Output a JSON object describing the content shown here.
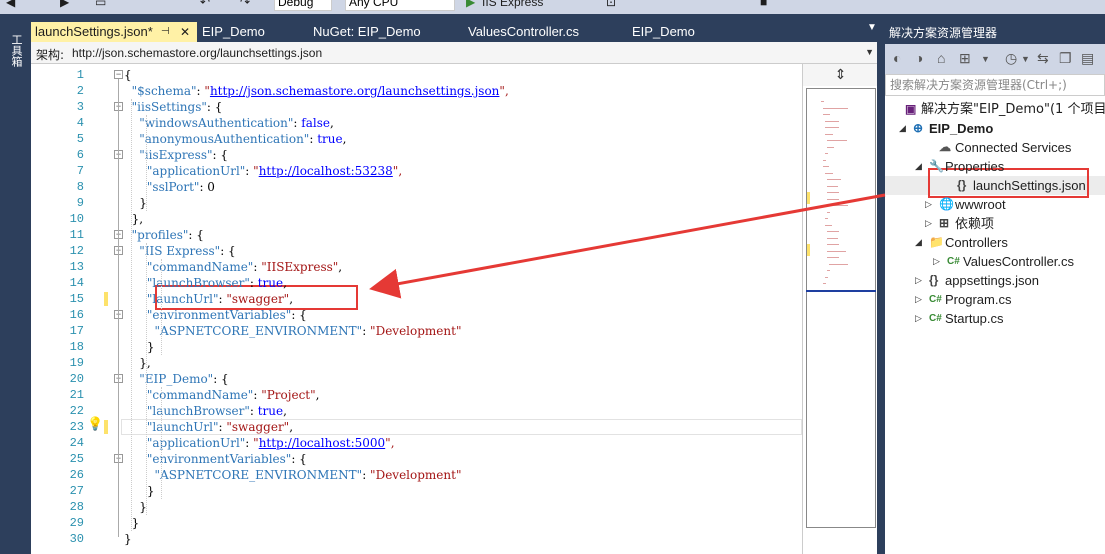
{
  "toolbar": {
    "config": "Debug",
    "platform": "Any CPU",
    "run_target": "IIS Express"
  },
  "left_tool": {
    "label": "工具箱"
  },
  "tabs": [
    {
      "label": "launchSettings.json*",
      "active": true
    },
    {
      "label": "EIP_Demo"
    },
    {
      "label": "NuGet: EIP_Demo"
    },
    {
      "label": "ValuesController.cs"
    },
    {
      "label": "EIP_Demo"
    }
  ],
  "schema_bar": {
    "label": "架构:",
    "value": "http://json.schemastore.org/launchsettings.json"
  },
  "code": {
    "line_numbers": [
      "1",
      "2",
      "3",
      "4",
      "5",
      "6",
      "7",
      "8",
      "9",
      "10",
      "11",
      "12",
      "13",
      "14",
      "15",
      "16",
      "17",
      "18",
      "19",
      "20",
      "21",
      "22",
      "23",
      "24",
      "25",
      "26",
      "27",
      "28",
      "29",
      "30"
    ],
    "lines": [
      [
        {
          "t": "{",
          "c": "n"
        }
      ],
      [
        {
          "t": "  \"$schema\"",
          "c": "k"
        },
        {
          "t": ": ",
          "c": "n"
        },
        {
          "t": "\"",
          "c": "s"
        },
        {
          "t": "http://json.schemastore.org/launchsettings.json",
          "c": "u"
        },
        {
          "t": "\",",
          "c": "s"
        }
      ],
      [
        {
          "t": "  \"iisSettings\"",
          "c": "k"
        },
        {
          "t": ": {",
          "c": "n"
        }
      ],
      [
        {
          "t": "    \"windowsAuthentication\"",
          "c": "k"
        },
        {
          "t": ": ",
          "c": "n"
        },
        {
          "t": "false",
          "c": "b"
        },
        {
          "t": ",",
          "c": "n"
        }
      ],
      [
        {
          "t": "    \"anonymousAuthentication\"",
          "c": "k"
        },
        {
          "t": ": ",
          "c": "n"
        },
        {
          "t": "true",
          "c": "b"
        },
        {
          "t": ",",
          "c": "n"
        }
      ],
      [
        {
          "t": "    \"iisExpress\"",
          "c": "k"
        },
        {
          "t": ": {",
          "c": "n"
        }
      ],
      [
        {
          "t": "      \"applicationUrl\"",
          "c": "k"
        },
        {
          "t": ": ",
          "c": "n"
        },
        {
          "t": "\"",
          "c": "s"
        },
        {
          "t": "http://localhost:53238",
          "c": "u"
        },
        {
          "t": "\",",
          "c": "s"
        }
      ],
      [
        {
          "t": "      \"sslPort\"",
          "c": "k"
        },
        {
          "t": ": 0",
          "c": "n"
        }
      ],
      [
        {
          "t": "    }",
          "c": "n"
        }
      ],
      [
        {
          "t": "  },",
          "c": "n"
        }
      ],
      [
        {
          "t": "  \"profiles\"",
          "c": "k"
        },
        {
          "t": ": {",
          "c": "n"
        }
      ],
      [
        {
          "t": "    \"IIS Express\"",
          "c": "k"
        },
        {
          "t": ": {",
          "c": "n"
        }
      ],
      [
        {
          "t": "      \"commandName\"",
          "c": "k"
        },
        {
          "t": ": ",
          "c": "n"
        },
        {
          "t": "\"IISExpress\"",
          "c": "s"
        },
        {
          "t": ",",
          "c": "n"
        }
      ],
      [
        {
          "t": "      \"launchBrowser\"",
          "c": "k"
        },
        {
          "t": ": ",
          "c": "n"
        },
        {
          "t": "true",
          "c": "b"
        },
        {
          "t": ",",
          "c": "n"
        }
      ],
      [
        {
          "t": "      \"launchUrl\"",
          "c": "k"
        },
        {
          "t": ": ",
          "c": "n"
        },
        {
          "t": "\"swagger\"",
          "c": "s"
        },
        {
          "t": ",",
          "c": "n"
        }
      ],
      [
        {
          "t": "      \"environmentVariables\"",
          "c": "k"
        },
        {
          "t": ": {",
          "c": "n"
        }
      ],
      [
        {
          "t": "        \"ASPNETCORE_ENVIRONMENT\"",
          "c": "k"
        },
        {
          "t": ": ",
          "c": "n"
        },
        {
          "t": "\"Development\"",
          "c": "s"
        }
      ],
      [
        {
          "t": "      }",
          "c": "n"
        }
      ],
      [
        {
          "t": "    },",
          "c": "n"
        }
      ],
      [
        {
          "t": "    \"EIP_Demo\"",
          "c": "k"
        },
        {
          "t": ": {",
          "c": "n"
        }
      ],
      [
        {
          "t": "      \"commandName\"",
          "c": "k"
        },
        {
          "t": ": ",
          "c": "n"
        },
        {
          "t": "\"Project\"",
          "c": "s"
        },
        {
          "t": ",",
          "c": "n"
        }
      ],
      [
        {
          "t": "      \"launchBrowser\"",
          "c": "k"
        },
        {
          "t": ": ",
          "c": "n"
        },
        {
          "t": "true",
          "c": "b"
        },
        {
          "t": ",",
          "c": "n"
        }
      ],
      [
        {
          "t": "      \"launchUrl\"",
          "c": "k"
        },
        {
          "t": ": ",
          "c": "n"
        },
        {
          "t": "\"swagger\"",
          "c": "s"
        },
        {
          "t": ",",
          "c": "n"
        }
      ],
      [
        {
          "t": "      \"applicationUrl\"",
          "c": "k"
        },
        {
          "t": ": ",
          "c": "n"
        },
        {
          "t": "\"",
          "c": "s"
        },
        {
          "t": "http://localhost:5000",
          "c": "u"
        },
        {
          "t": "\",",
          "c": "s"
        }
      ],
      [
        {
          "t": "      \"environmentVariables\"",
          "c": "k"
        },
        {
          "t": ": {",
          "c": "n"
        }
      ],
      [
        {
          "t": "        \"ASPNETCORE_ENVIRONMENT\"",
          "c": "k"
        },
        {
          "t": ": ",
          "c": "n"
        },
        {
          "t": "\"Development\"",
          "c": "s"
        }
      ],
      [
        {
          "t": "      }",
          "c": "n"
        }
      ],
      [
        {
          "t": "    }",
          "c": "n"
        }
      ],
      [
        {
          "t": "  }",
          "c": "n"
        }
      ],
      [
        {
          "t": "}",
          "c": "n"
        }
      ]
    ]
  },
  "solution_explorer": {
    "title": "解决方案资源管理器",
    "search_placeholder": "搜索解决方案资源管理器(Ctrl+;)",
    "tree": [
      {
        "label": "解决方案\"EIP_Demo\"(1 个项目)",
        "icon": "solution-icon"
      },
      {
        "label": "EIP_Demo",
        "icon": "web-project-icon",
        "bold": true
      },
      {
        "label": "Connected Services",
        "icon": "cloud-icon"
      },
      {
        "label": "Properties",
        "icon": "wrench-icon"
      },
      {
        "label": "launchSettings.json",
        "icon": "json-file-icon",
        "selected": true
      },
      {
        "label": "wwwroot",
        "icon": "globe-icon"
      },
      {
        "label": "依赖项",
        "icon": "dependencies-icon"
      },
      {
        "label": "Controllers",
        "icon": "folder-icon"
      },
      {
        "label": "ValuesController.cs",
        "icon": "csharp-file-icon"
      },
      {
        "label": "appsettings.json",
        "icon": "json-file-icon"
      },
      {
        "label": "Program.cs",
        "icon": "csharp-file-icon"
      },
      {
        "label": "Startup.cs",
        "icon": "csharp-file-icon"
      }
    ]
  },
  "colors": {
    "accent": "#2d3f5c",
    "active_tab": "#fff1a6",
    "highlight": "#e53935"
  }
}
